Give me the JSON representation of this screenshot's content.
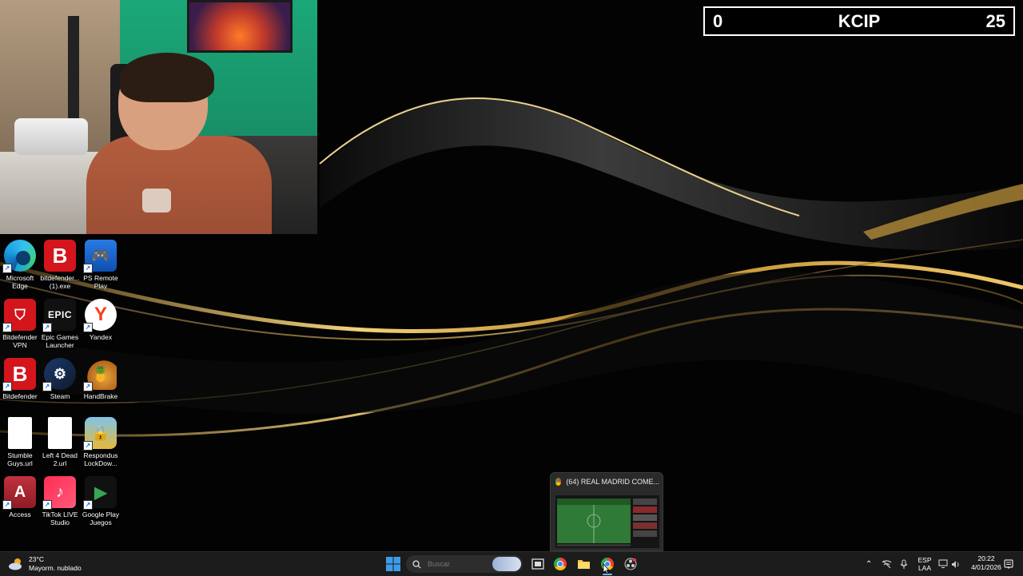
{
  "scoreboard": {
    "left_score": "0",
    "team": "KCIP",
    "right_score": "25"
  },
  "desktop_icons": [
    {
      "label": "Microsoft Edge",
      "icon": "edge-icon"
    },
    {
      "label": "bitdefender... (1).exe",
      "icon": "bitdefender-icon"
    },
    {
      "label": "PS Remote Play",
      "icon": "ps-remote-play-icon"
    },
    {
      "label": "Bitdefender VPN",
      "icon": "bitdefender-vpn-icon"
    },
    {
      "label": "Epic Games Launcher",
      "icon": "epic-games-icon",
      "glyph": "EPIC"
    },
    {
      "label": "Yandex",
      "icon": "yandex-icon",
      "glyph": "Y"
    },
    {
      "label": "Bitdefender",
      "icon": "bitdefender-icon",
      "glyph": "B"
    },
    {
      "label": "Steam",
      "icon": "steam-icon"
    },
    {
      "label": "HandBrake",
      "icon": "handbrake-icon"
    },
    {
      "label": "Stumble Guys.url",
      "icon": "file-icon"
    },
    {
      "label": "Left 4 Dead 2.url",
      "icon": "file-icon"
    },
    {
      "label": "Respondus LockDow...",
      "icon": "respondus-icon"
    },
    {
      "label": "Access",
      "icon": "access-icon",
      "glyph": "A"
    },
    {
      "label": "TikTok LIVE Studio",
      "icon": "tiktok-icon"
    },
    {
      "label": "Google Play Juegos",
      "icon": "google-play-games-icon"
    }
  ],
  "taskbar": {
    "weather": {
      "temp": "23°C",
      "desc": "Mayorm. nublado"
    },
    "search_placeholder": "Buscar",
    "language": {
      "lang": "ESP",
      "region": "LAA"
    },
    "clock": {
      "time": "20:22",
      "date": "4/01/2026"
    }
  },
  "preview": {
    "title": "(64) REAL MADRID COME..."
  },
  "colors": {
    "gold": "#d4a83c",
    "taskbar": "#1c1c1c",
    "bitdefender": "#d4151b"
  }
}
